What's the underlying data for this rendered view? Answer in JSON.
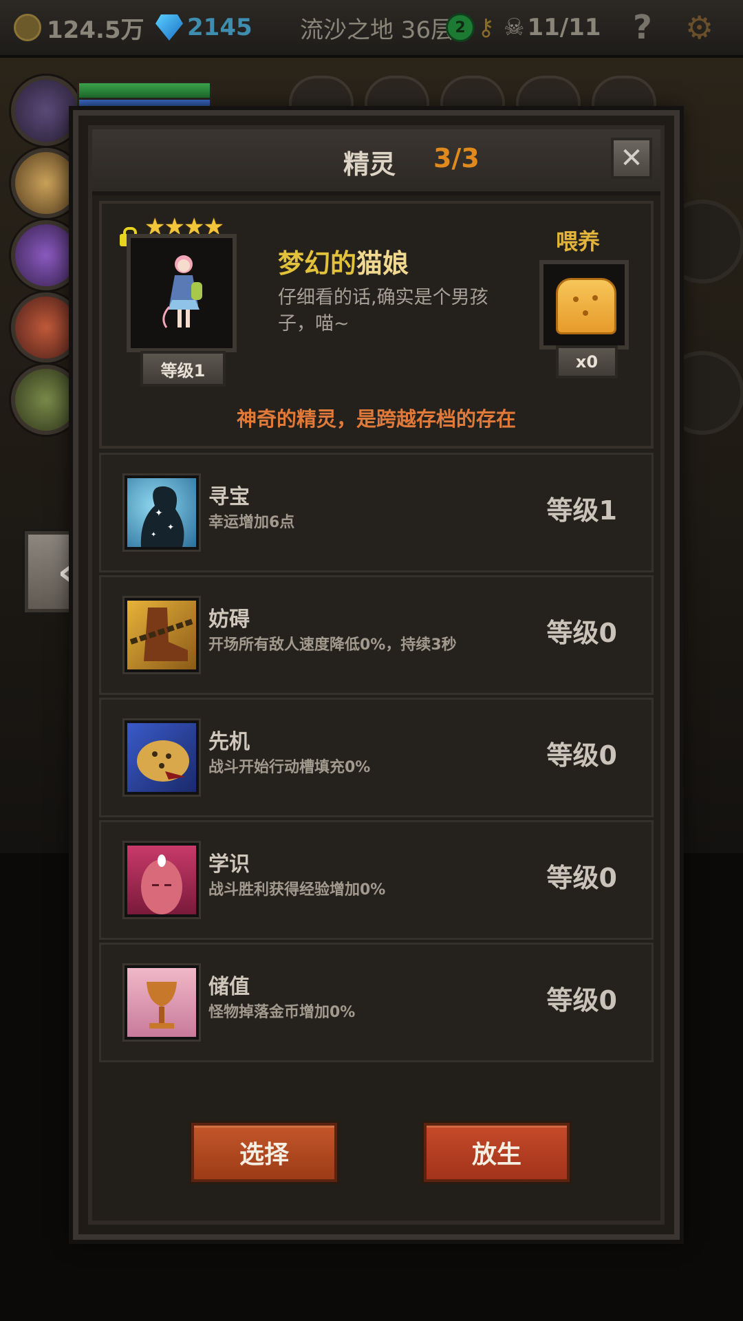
{
  "topbar": {
    "gold": "124.5万",
    "gems": "2145",
    "location": "流沙之地 36层",
    "key_badge": "2",
    "kills": "11/11",
    "help": "?"
  },
  "dialog": {
    "title": "精灵",
    "count": "3/3",
    "close": "✕"
  },
  "sprite": {
    "stars": "★★★★",
    "level": "等级1",
    "name_part1": "梦幻的",
    "name_part2": "猫娘",
    "description": "仔细看的话,确实是个男孩子，喵~",
    "feed_label": "喂养",
    "feed_count": "x0",
    "tagline": "神奇的精灵，是跨越存档的存在"
  },
  "skills": [
    {
      "name": "寻宝",
      "desc": "幸运增加6点",
      "level": "等级1",
      "icon": "treasure-silhouette-icon"
    },
    {
      "name": "妨碍",
      "desc": "开场所有敌人速度降低0%，持续3秒",
      "level": "等级0",
      "icon": "chained-boot-icon"
    },
    {
      "name": "先机",
      "desc": "战斗开始行动槽填充0%",
      "level": "等级0",
      "icon": "leopard-icon"
    },
    {
      "name": "学识",
      "desc": "战斗胜利获得经验增加0%",
      "level": "等级0",
      "icon": "third-eye-head-icon"
    },
    {
      "name": "储值",
      "desc": "怪物掉落金币增加0%",
      "level": "等级0",
      "icon": "golden-goblet-icon"
    }
  ],
  "buttons": {
    "select": "选择",
    "release": "放生"
  },
  "nav": {
    "prev": "‹"
  }
}
